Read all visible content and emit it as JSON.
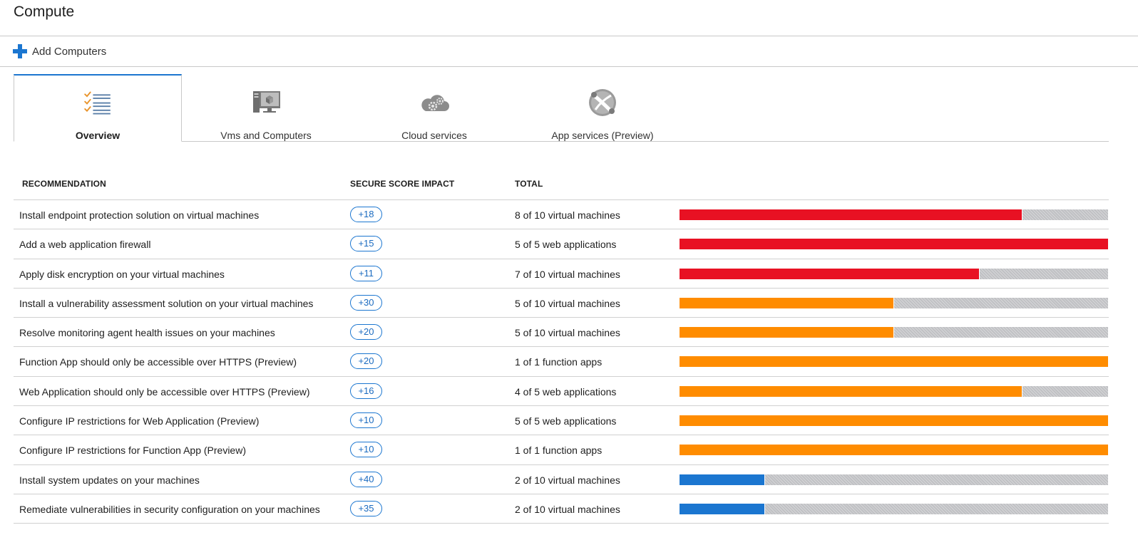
{
  "page": {
    "title": "Compute"
  },
  "toolbar": {
    "add_label": "Add Computers"
  },
  "colors": {
    "critical": "#e81123",
    "warning": "#ff8c00",
    "low": "#1b76d0",
    "remaining": "#c0c1c4",
    "accent": "#1b76d0"
  },
  "tabs": [
    {
      "label": "Overview",
      "icon": "checklist-icon",
      "active": true
    },
    {
      "label": "Vms and Computers",
      "icon": "computer-icon",
      "active": false
    },
    {
      "label": "Cloud services",
      "icon": "cloud-gear-icon",
      "active": false
    },
    {
      "label": "App services (Preview)",
      "icon": "globe-wrench-icon",
      "active": false
    }
  ],
  "table": {
    "headers": {
      "recommendation": "RECOMMENDATION",
      "impact": "SECURE SCORE IMPACT",
      "total": "TOTAL"
    },
    "rows": [
      {
        "recommendation": "Install endpoint protection solution on virtual machines",
        "impact": "+18",
        "total": "8 of 10 virtual machines",
        "fraction": 0.8,
        "severity": "critical"
      },
      {
        "recommendation": "Add a web application firewall",
        "impact": "+15",
        "total": "5 of 5 web applications",
        "fraction": 1.0,
        "severity": "critical"
      },
      {
        "recommendation": "Apply disk encryption on your virtual machines",
        "impact": "+11",
        "total": "7 of 10 virtual machines",
        "fraction": 0.7,
        "severity": "critical"
      },
      {
        "recommendation": "Install a vulnerability assessment solution on your virtual machines",
        "impact": "+30",
        "total": "5 of 10 virtual machines",
        "fraction": 0.5,
        "severity": "warning"
      },
      {
        "recommendation": "Resolve monitoring agent health issues on your machines",
        "impact": "+20",
        "total": "5 of 10 virtual machines",
        "fraction": 0.5,
        "severity": "warning"
      },
      {
        "recommendation": "Function App should only be accessible over HTTPS (Preview)",
        "impact": "+20",
        "total": "1 of 1 function apps",
        "fraction": 1.0,
        "severity": "warning"
      },
      {
        "recommendation": "Web Application should only be accessible over HTTPS (Preview)",
        "impact": "+16",
        "total": "4 of 5 web applications",
        "fraction": 0.8,
        "severity": "warning"
      },
      {
        "recommendation": "Configure IP restrictions for Web Application (Preview)",
        "impact": "+10",
        "total": "5 of 5 web applications",
        "fraction": 1.0,
        "severity": "warning"
      },
      {
        "recommendation": "Configure IP restrictions for Function App (Preview)",
        "impact": "+10",
        "total": "1 of 1 function apps",
        "fraction": 1.0,
        "severity": "warning"
      },
      {
        "recommendation": "Install system updates on your machines",
        "impact": "+40",
        "total": "2 of 10 virtual machines",
        "fraction": 0.2,
        "severity": "low"
      },
      {
        "recommendation": "Remediate vulnerabilities in security configuration on your machines",
        "impact": "+35",
        "total": "2 of 10 virtual machines",
        "fraction": 0.2,
        "severity": "low"
      }
    ]
  }
}
